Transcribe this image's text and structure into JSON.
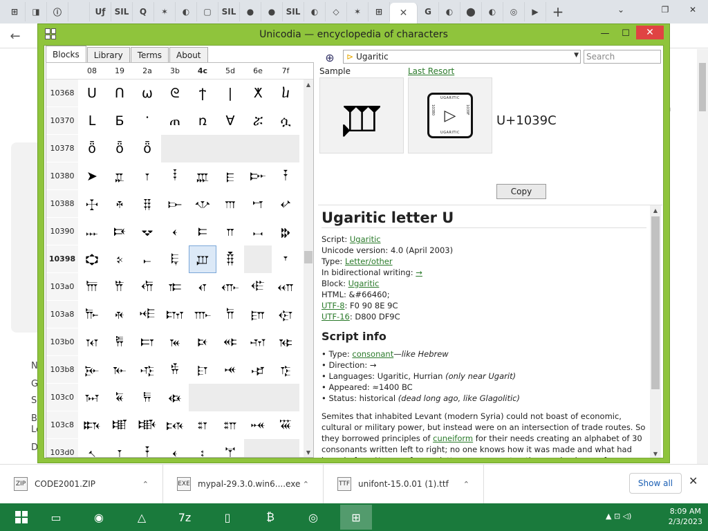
{
  "browser": {
    "tabs": [
      "⊞",
      "◨",
      "ⓘ",
      "",
      "Uƒ",
      "SIL",
      "Q",
      "✶",
      "◐",
      "▢",
      "SIL",
      "●",
      "●",
      "SIL",
      "◐",
      "◇",
      "✶",
      "⊞",
      "G",
      "◐",
      "⬤",
      "◐",
      "◎",
      "▶"
    ],
    "active_tab_close": "✕",
    "new_tab": "+",
    "tab_dropdown": "⌄",
    "win_min": "—",
    "win_max": "❐",
    "win_close": "✕",
    "back": "←"
  },
  "page_behind": {
    "letters": [
      "N",
      "G",
      "Sc",
      "Bi",
      "Le",
      "D"
    ],
    "right_text": "th"
  },
  "app": {
    "title": "Unicodia — encyclopedia of characters",
    "btn_min": "—",
    "btn_max": "☐",
    "btn_close": "✕",
    "tabs": [
      "Blocks",
      "Library",
      "Terms",
      "About"
    ],
    "grid": {
      "columns": [
        "08",
        "19",
        "2a",
        "3b",
        "4c",
        "5d",
        "6e",
        "7f"
      ],
      "bold_column": "4c",
      "rows": [
        {
          "label": "10368",
          "cells": [
            "ᑌ",
            "ᑎ",
            "ω",
            "ᘓ",
            "ϯ",
            "|",
            "ⵅ",
            "ⴑ"
          ]
        },
        {
          "label": "10370",
          "cells": [
            "ᒪ",
            "Ƃ",
            "ᱸ",
            "ጠ",
            "ռ",
            "∀",
            "ሯ",
            "ሷ"
          ]
        },
        {
          "label": "10378",
          "cells": [
            "ȫ",
            "ȫ",
            "ȫ"
          ]
        },
        {
          "label": "10380",
          "cells": [
            "➤",
            "𐎁",
            "𐎂",
            "𐎃",
            "𐎄",
            "𐎅",
            "𐎆",
            "𐎇"
          ]
        },
        {
          "label": "10388",
          "cells": [
            "𐎈",
            "𐎉",
            "𐎊",
            "𐎋",
            "𐎌",
            "𐎍",
            "𐎎",
            "𐎏"
          ]
        },
        {
          "label": "10390",
          "cells": [
            "𐎐",
            "𐎑",
            "𐎒",
            "𐎓",
            "𐎔",
            "𐎕",
            "𐎖",
            "𐎗"
          ]
        },
        {
          "label": "10398",
          "bold": true,
          "cells": [
            "𐎘",
            "𐎙",
            "𐎚",
            "𐎛",
            "𐎜",
            "𐎝",
            "",
            "𐎟"
          ]
        },
        {
          "label": "103a0",
          "cells": [
            "𐎠",
            "𐎡",
            "𐎢",
            "𐎣",
            "𐎤",
            "𐎥",
            "𐎦",
            "𐎧"
          ]
        },
        {
          "label": "103a8",
          "cells": [
            "𐎨",
            "𐎩",
            "𐎪",
            "𐎫",
            "𐎬",
            "𐎭",
            "𐎮",
            "𐎯"
          ]
        },
        {
          "label": "103b0",
          "cells": [
            "𐎰",
            "𐎱",
            "𐎲",
            "𐎳",
            "𐎴",
            "𐎵",
            "𐎶",
            "𐎷"
          ]
        },
        {
          "label": "103b8",
          "cells": [
            "𐎸",
            "𐎹",
            "𐎺",
            "𐎻",
            "𐎼",
            "𐎽",
            "𐎾",
            "𐎿"
          ]
        },
        {
          "label": "103c0",
          "cells": [
            "𐏀",
            "𐏁",
            "𐏂",
            "𐏃"
          ]
        },
        {
          "label": "103c8",
          "cells": [
            "𐏈",
            "𐏉",
            "𐏊",
            "𐏋",
            "𐏌",
            "𐏍",
            "𐏎",
            "𐏏"
          ]
        },
        {
          "label": "103d0",
          "cells": [
            "𐏐",
            "𐏑",
            "𐏒",
            "𐏓",
            "𐏔",
            "𐏕"
          ]
        }
      ],
      "selected": {
        "row": 6,
        "col": 4
      }
    },
    "block_select": "Ugaritic",
    "search_placeholder": "Search",
    "sample_label": "Sample",
    "last_resort_label": "Last Resort",
    "sample_glyph": "𐎜",
    "lr_top": "UGARITIC",
    "lr_bottom": "UGARITIC",
    "lr_left": "10380",
    "lr_right": "1039F",
    "lr_arrow": "▷",
    "codepoint": "U+1039C",
    "copy_label": "Copy",
    "info": {
      "title": "Ugaritic letter U",
      "script_label": "Script: ",
      "script_value": "Ugaritic",
      "version": "Unicode version: 4.0 (April 2003)",
      "type_label": "Type: ",
      "type_value": "Letter/other",
      "bidi_label": "In bidirectional writing: ",
      "bidi_value": "→",
      "block_label": "Block: ",
      "block_value": "Ugaritic",
      "html": "HTML: &#66460;",
      "utf8_label": "UTF-8",
      "utf8_value": ": F0 90 8E 9C",
      "utf16_label": "UTF-16",
      "utf16_value": ": D800 DF9C",
      "script_info_heading": "Script info",
      "si_type_prefix": "• Type: ",
      "si_type_link": "consonant",
      "si_type_suffix": "—",
      "si_type_italic": "like Hebrew",
      "si_direction": "• Direction: →",
      "si_languages": "• Languages: Ugaritic, Hurrian ",
      "si_languages_italic": "(only near Ugarit)",
      "si_appeared": "• Appeared: ≈1400 BC",
      "si_status": "• Status: historical ",
      "si_status_italic": "(dead long ago, like Glagolitic)",
      "para_1": "Semites that inhabited Levant (modern Syria) could not boast of economic, cultural or military power, but instead were on an intersection of trade routes. So they borrowed principles of ",
      "para_link": "cuneiform",
      "para_2": " for their needs creating an alphabet of 30 consonants written left to right; no one knows how it was made and what had been before. Names of many letters are reconstructions and unknown for sure. The only punctuation mark is word"
    }
  },
  "downloads": {
    "items": [
      {
        "name": "CODE2001.ZIP",
        "icon": "ZIP"
      },
      {
        "name": "mypal-29.3.0.win6....exe",
        "icon": "EXE"
      },
      {
        "name": "unifont-15.0.01 (1).ttf",
        "icon": "TTF"
      }
    ],
    "show_all": "Show all",
    "close": "✕",
    "chevron": "⌃"
  },
  "taskbar": {
    "items": [
      "▦",
      "▭",
      "◉",
      "△",
      "7z",
      "▯",
      "₿",
      "◎",
      "⊞"
    ],
    "time": "8:09 AM",
    "date": "2/3/2023",
    "tray": "▲ ⊡ ◁)"
  },
  "colors": {
    "app_frame": "#8fc43c",
    "link": "#2a7a2a",
    "taskbar": "#1a7a3c",
    "close": "#e04343"
  }
}
